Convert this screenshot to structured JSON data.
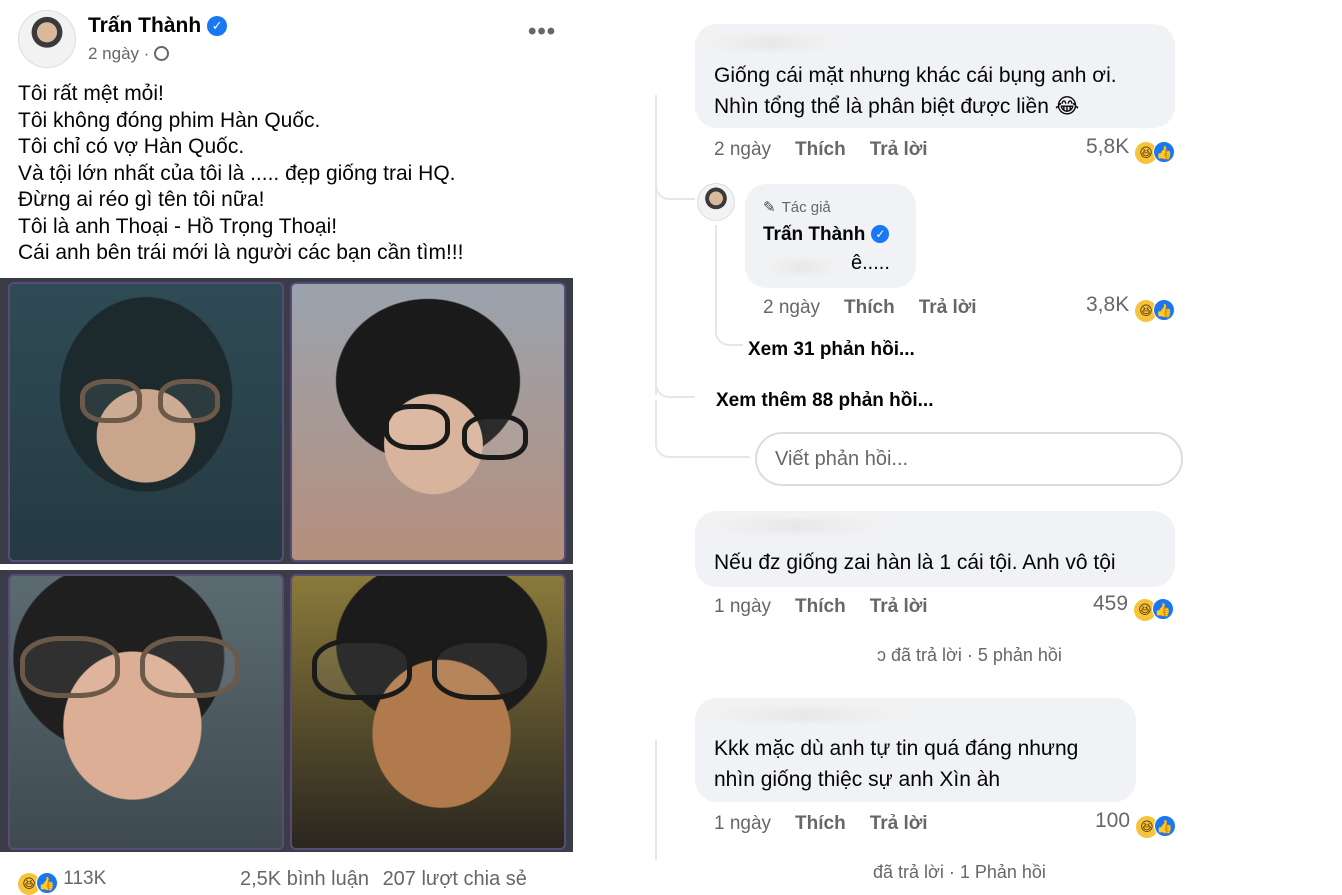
{
  "post": {
    "author": "Trấn Thành",
    "verified_mark": "✓",
    "time": "2 ngày",
    "dot": "·",
    "more_glyph": "•••",
    "text": "Tôi rất mệt mỏi!\nTôi không đóng phim Hàn Quốc.\nTôi chỉ có vợ Hàn Quốc.\nVà tội lớn nhất của tôi là ..... đẹp giống trai HQ.\nĐừng ai réo gì tên tôi nữa!\nTôi là anh Thoại - Hồ Trọng Thoại!\nCái anh bên trái mới là người các bạn cần tìm!!!",
    "reaction_count": "113K",
    "comments": "2,5K bình luận",
    "shares": "207 lượt chia sẻ",
    "icons": [
      "haha-reaction-icon",
      "like-reaction-icon",
      "globe-icon",
      "verified-badge-icon",
      "more-options-icon"
    ]
  },
  "comments": [
    {
      "text": "Giống cái mặt nhưng khác cái bụng anh ơi.\nNhìn tổng thể là phân biệt được liền 😂",
      "time": "2 ngày",
      "like_label": "Thích",
      "reply_label": "Trả lời",
      "count": "5,8K"
    },
    {
      "author_tag": "Tác giả",
      "author": "Trấn Thành",
      "text": "ê.....",
      "time": "2 ngày",
      "like_label": "Thích",
      "reply_label": "Trả lời",
      "count": "3,8K"
    },
    {
      "text": "Nếu đz giống zai hàn là 1 cái tội. Anh vô tội",
      "time": "1 ngày",
      "like_label": "Thích",
      "reply_label": "Trả lời",
      "count": "459",
      "replies_summary_a": "ɔ đã trả lời",
      "replies_summary_b": "· 5 phản hồi"
    },
    {
      "text": "Kkk mặc dù anh tự tin quá đáng nhưng\nnhìn giống thiệc sự anh Xìn àh",
      "time": "1 ngày",
      "like_label": "Thích",
      "reply_label": "Trả lời",
      "count": "100",
      "replies_summary_a": "đã trả lời",
      "replies_summary_b": "· 1 Phản hồi"
    }
  ],
  "view_replies": "Xem 31 phản hồi...",
  "view_more_replies": "Xem thêm 88 phản hồi...",
  "reply_placeholder": "Viết phản hồi...",
  "emoji": {
    "haha": "😆",
    "like": "👍",
    "pen": "✎"
  }
}
